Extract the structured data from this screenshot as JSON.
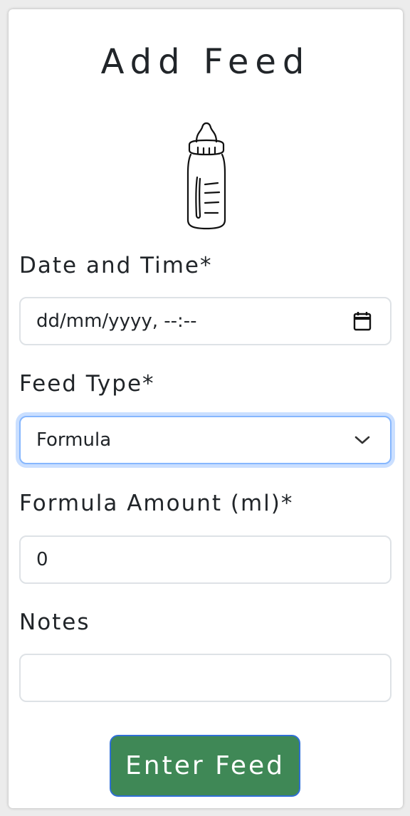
{
  "form": {
    "title": "Add Feed",
    "bottle_icon": "baby-bottle-icon",
    "date_time": {
      "label": "Date and Time*",
      "value": "dd/mm/yyyy, --:--",
      "icon": "calendar-icon"
    },
    "feed_type": {
      "label": "Feed Type*",
      "selected": "Formula",
      "icon": "chevron-down-icon"
    },
    "formula_amount": {
      "label": "Formula Amount (ml)*",
      "value": "0"
    },
    "notes": {
      "label": "Notes",
      "value": ""
    },
    "submit_label": "Enter Feed"
  },
  "colors": {
    "submit_bg": "#3f8856",
    "focus_ring": "#86b7fe",
    "text": "#212529"
  }
}
